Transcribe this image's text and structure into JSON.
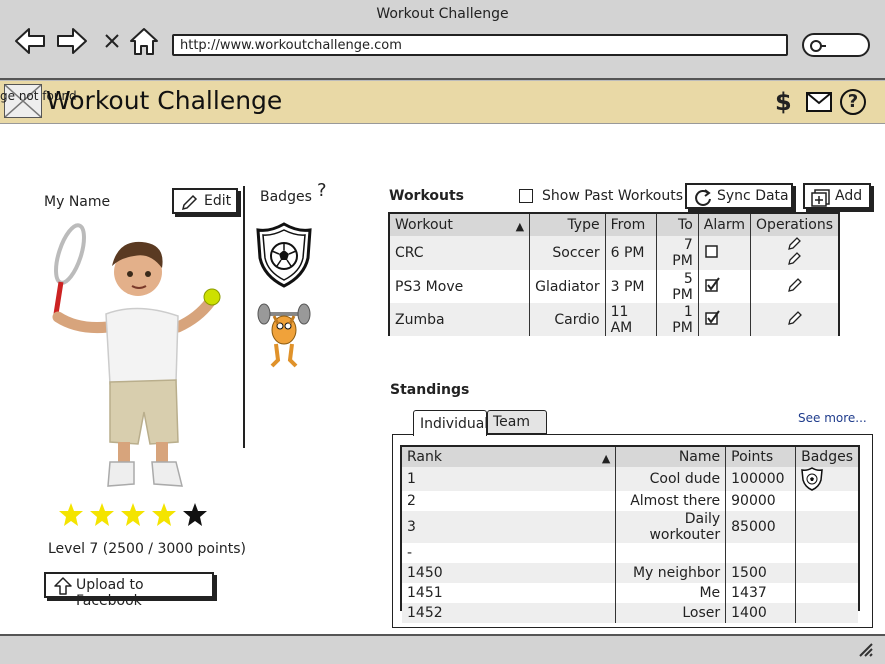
{
  "browser": {
    "title": "Workout Challenge",
    "url": "http://www.workoutchallenge.com"
  },
  "header": {
    "logo_alt": "ge not found",
    "title": "Workout Challenge"
  },
  "profile": {
    "name": "My Name",
    "edit_label": "Edit",
    "rating": {
      "filled": 4,
      "total": 5
    },
    "level_text": "Level 7 (2500 / 3000 points)",
    "upload_label": "Upload to Facebook"
  },
  "badges": {
    "label": "Badges",
    "help": "?",
    "items": [
      "soccer-badge",
      "weightlifter-badge"
    ]
  },
  "workouts": {
    "heading": "Workouts",
    "show_past_label": "Show Past Workouts",
    "sync_label": "Sync Data",
    "add_label": "Add",
    "columns": [
      "Workout",
      "Type",
      "From",
      "To",
      "Alarm",
      "Operations"
    ],
    "rows": [
      {
        "workout": "CRC",
        "type": "Soccer",
        "from": "6 PM",
        "to": "7 PM",
        "alarm": false
      },
      {
        "workout": "PS3 Move",
        "type": "Gladiator",
        "from": "3 PM",
        "to": "5 PM",
        "alarm": true
      },
      {
        "workout": "Zumba",
        "type": "Cardio",
        "from": "11 AM",
        "to": "1 PM",
        "alarm": true
      }
    ]
  },
  "standings": {
    "heading": "Standings",
    "tabs": [
      "Individual",
      "Team"
    ],
    "see_more": "See more...",
    "columns": [
      "Rank",
      "Name",
      "Points",
      "Badges"
    ],
    "rows": [
      {
        "rank": "1",
        "name": "Cool dude",
        "points": "100000",
        "badge": true
      },
      {
        "rank": "2",
        "name": "Almost there",
        "points": "90000",
        "badge": false
      },
      {
        "rank": "3",
        "name": "Daily workouter",
        "points": "85000",
        "badge": false
      },
      {
        "rank": "-",
        "name": "",
        "points": "",
        "badge": false
      },
      {
        "rank": "1450",
        "name": "My neighbor",
        "points": "1500",
        "badge": false
      },
      {
        "rank": "1451",
        "name": "Me",
        "points": "1437",
        "badge": false
      },
      {
        "rank": "1452",
        "name": "Loser",
        "points": "1400",
        "badge": false
      }
    ]
  },
  "colors": {
    "header_bg": "#e9d9a6",
    "chrome_bg": "#d3d3d3",
    "table_header_bg": "#d7d7d7",
    "star_filled": "#f4e400",
    "star_empty": "#111111",
    "link": "#1f3c8c"
  }
}
